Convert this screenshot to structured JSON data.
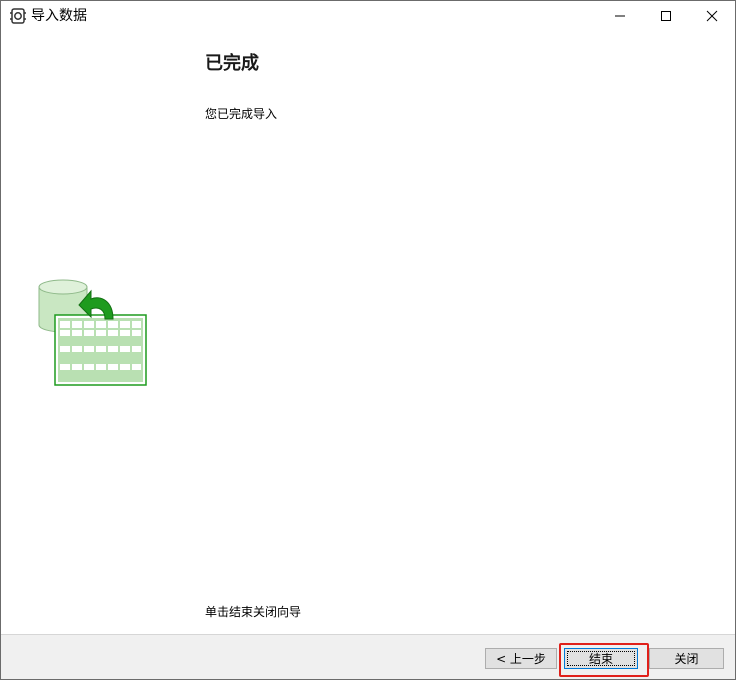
{
  "window": {
    "title": "导入数据",
    "controls": {
      "minimize": "minimize-icon",
      "maximize": "maximize-icon",
      "close": "close-icon"
    }
  },
  "page": {
    "heading": "已完成",
    "message": "您已完成导入",
    "hint": "单击结束关闭向导",
    "illustration": "import-data-icon"
  },
  "footer": {
    "back_label": "< 上一步",
    "finish_label": "结束",
    "close_label": "关闭"
  },
  "colors": {
    "highlight": "#e0201a",
    "accent": "#0078d7",
    "icon_green": "#1e9b1e"
  }
}
